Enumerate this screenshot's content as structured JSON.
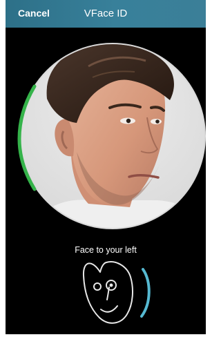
{
  "header": {
    "cancel_label": "Cancel",
    "title": "VFace ID"
  },
  "scan": {
    "progress_color": "#35b34a",
    "ring_color": "#d9d9d9",
    "portrait_background": "#e7e7e7"
  },
  "guide": {
    "instruction": "Face to your left",
    "direction_arc_color": "#56b9d1",
    "face_outline_color": "#e8e8e8"
  },
  "icons": {
    "face_guide": "face-left-guide-icon",
    "direction": "direction-arc-icon"
  }
}
